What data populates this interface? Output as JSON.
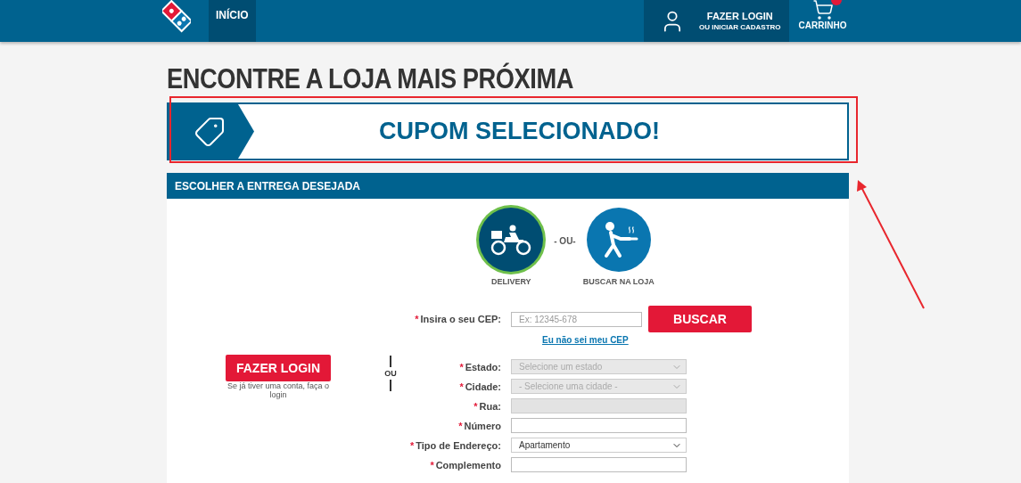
{
  "header": {
    "nav": [
      {
        "label": "INÍCIO",
        "selected": true
      }
    ],
    "login": {
      "title": "FAZER LOGIN",
      "subtitle": "OU INICIAR CADASTRO"
    },
    "cart": {
      "label": "CARRINHO"
    }
  },
  "page_title": "ENCONTRE A LOJA MAIS PRÓXIMA",
  "coupon_banner": {
    "text": "CUPOM SELECIONADO!"
  },
  "delivery_panel": {
    "title": "ESCOLHER A ENTREGA DESEJADA",
    "options": [
      {
        "kind": "delivery",
        "label": "DELIVERY",
        "selected": true
      },
      {
        "kind": "pickup",
        "label": "BUSCAR NA LOJA",
        "selected": false
      }
    ],
    "separator": "- OU-",
    "required_mark": "*",
    "cep": {
      "label": "Insira o seu CEP:",
      "required": true,
      "placeholder": "Ex: 12345-678",
      "button": "BUSCAR",
      "link": "Eu não sei meu CEP"
    },
    "login_button": "FAZER LOGIN",
    "login_hint": "Se já tiver uma conta, faça o login",
    "or_divider": "OU",
    "fields": [
      {
        "kind": "select",
        "label": "Estado:",
        "required": true,
        "placeholder": "Selecione um estado",
        "disabled": true
      },
      {
        "kind": "select",
        "label": "Cidade:",
        "required": true,
        "placeholder": "- Selecione uma cidade -",
        "disabled": true
      },
      {
        "kind": "text",
        "label": "Rua:",
        "required": true,
        "disabled": true
      },
      {
        "kind": "text",
        "label": "Número",
        "required": true,
        "disabled": false
      },
      {
        "kind": "select",
        "label": "Tipo de Endereço:",
        "required": true,
        "value": "Apartamento",
        "disabled": false
      },
      {
        "kind": "text",
        "label": "Complemento",
        "required": true,
        "disabled": false
      }
    ]
  }
}
